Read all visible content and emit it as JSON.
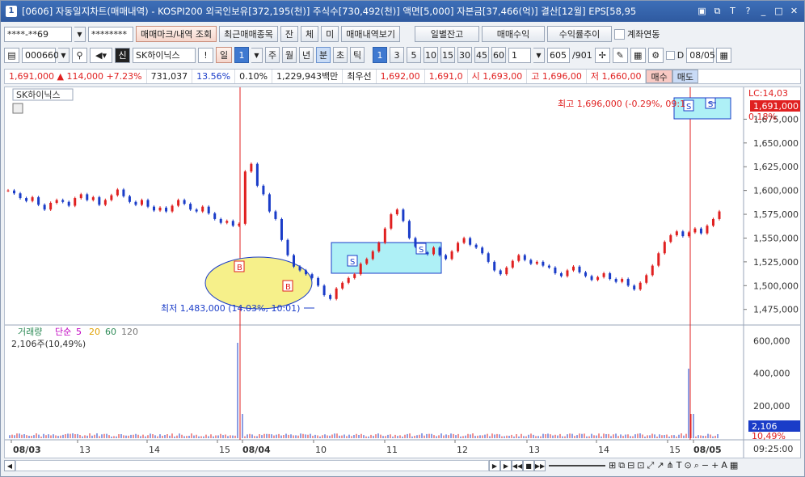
{
  "window": {
    "number": "1",
    "title": "[0606] 자동일지차트(매매내역) - KOSPI200 외국인보유[372,195(천)] 주식수[730,492(천)] 액면[5,000] 자본금[37,466(억)] 결산[12월] EPS[58,95"
  },
  "toolbar1": {
    "account": "****-**69",
    "password": "********",
    "buttons": [
      "매매마크/내역 조회",
      "최근매매종목",
      "잔",
      "체",
      "미",
      "매매내역보기",
      "일별잔고",
      "매매수익",
      "수익률추이"
    ],
    "checkbox_label": "계좌연동"
  },
  "toolbar2": {
    "code": "000660",
    "new_badge": "신",
    "stock_name": "SK하이닉스",
    "warn": "!",
    "period_day": "일",
    "period_num": "1",
    "periods": [
      "주",
      "월",
      "년",
      "분",
      "초",
      "틱"
    ],
    "minutes": [
      "1",
      "3",
      "5",
      "10",
      "15",
      "30",
      "45",
      "60"
    ],
    "count": "1",
    "view": "605",
    "total": "/901",
    "date": "08/05"
  },
  "quote": {
    "price": "1,691,000",
    "arrow": "▲",
    "change": "114,000",
    "pct": "+7.23%",
    "volume": "731,037",
    "vol_pct": "13.56%",
    "v2": "0.10%",
    "amount": "1,229,943백만",
    "best": "최우선",
    "bid": "1,692,00",
    "ask": "1,691,0",
    "open": "시 1,693,00",
    "high": "고 1,696,00",
    "low": "저 1,660,00",
    "buy": "매수",
    "sell": "매도"
  },
  "chart_data": {
    "type": "line",
    "title": "SK하이닉스",
    "ylim": [
      1462000,
      1700000
    ],
    "yticks": [
      1475000,
      1500000,
      1525000,
      1550000,
      1575000,
      1600000,
      1625000,
      1650000,
      1675000
    ],
    "ytick_labels": [
      "1,475,000",
      "1,500,000",
      "1,525,000",
      "1,550,000",
      "1,575,000",
      "1,600,000",
      "1,625,000",
      "1,650,000",
      "1,675,000"
    ],
    "lc_label": "LC:14,03",
    "last_price_label": "1,691,000",
    "pct_label": "0.18%",
    "high_annotation": "최고 1,696,000 (-0.29%, 09:1",
    "low_annotation": "최저 1,483,000 (14.03%, 10:01)",
    "series": [
      {
        "values": [
          1600000,
          1597000,
          1592000,
          1589000,
          1593000,
          1585000,
          1580000,
          1587000,
          1590000,
          1588000,
          1584000,
          1592000,
          1596000,
          1590000,
          1593000,
          1585000,
          1590000,
          1595000,
          1601000,
          1594000,
          1588000,
          1585000,
          1590000,
          1583000,
          1579000,
          1582000,
          1578000,
          1584000,
          1590000,
          1586000,
          1580000,
          1578000,
          1583000,
          1576000,
          1570000,
          1566000,
          1568000,
          1563000,
          1565000,
          1620000,
          1628000,
          1605000,
          1596000,
          1578000,
          1570000,
          1548000,
          1532000,
          1520000,
          1516000,
          1512000,
          1508000,
          1500000,
          1490000,
          1486000,
          1497000,
          1503000,
          1508000,
          1512000,
          1523000,
          1528000,
          1536000,
          1545000,
          1560000,
          1575000,
          1580000,
          1568000,
          1550000,
          1541000,
          1535000,
          1533000,
          1540000,
          1532000,
          1528000,
          1536000,
          1545000,
          1550000,
          1543000,
          1540000,
          1534000,
          1525000,
          1516000,
          1512000,
          1519000,
          1526000,
          1532000,
          1527000,
          1523000,
          1525000,
          1521000,
          1519000,
          1513000,
          1510000,
          1516000,
          1520000,
          1514000,
          1510000,
          1506000,
          1509000,
          1513000,
          1507000,
          1504000,
          1507000,
          1500000,
          1496000,
          1503000,
          1511000,
          1521000,
          1534000,
          1546000,
          1553000,
          1557000,
          1552000,
          1556000,
          1560000,
          1555000,
          1563000,
          1570000,
          1578000
        ]
      }
    ],
    "xticks": [
      "08/03",
      "13",
      "14",
      "15",
      "08/04",
      "10",
      "11",
      "12",
      "13",
      "14",
      "15",
      "08/05"
    ],
    "vol_labels": [
      "600,000",
      "400,000",
      "200,000"
    ],
    "vol_legend": [
      "거래량",
      "단순",
      "5",
      "20",
      "60",
      "120"
    ],
    "vol_value": "2,106주(10,49%)",
    "vol_badge": "2,106",
    "vol_pct": "10,49%",
    "time": "09:25:00"
  },
  "colors": {
    "up": "#e02020",
    "down": "#1a3cc8",
    "accent": "#2f5aa0"
  }
}
